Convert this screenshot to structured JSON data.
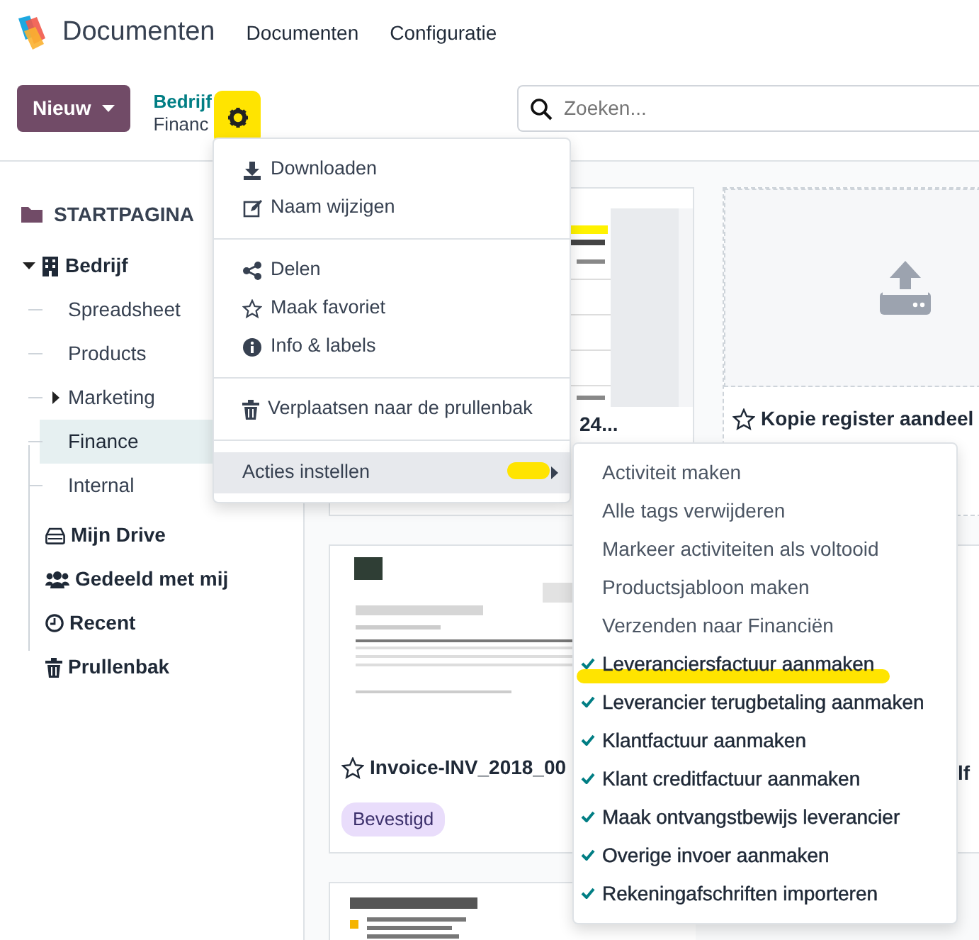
{
  "app": {
    "name": "Documenten"
  },
  "nav": [
    "Documenten",
    "Configuratie"
  ],
  "new_button": {
    "label": "Nieuw"
  },
  "breadcrumb": [
    {
      "label": "Bedrijf",
      "kind": "link"
    },
    {
      "label": "Financ",
      "kind": "current"
    }
  ],
  "search": {
    "placeholder": "Zoeken..."
  },
  "sidebar": {
    "root": "STARTPAGINA",
    "tree": [
      {
        "label": "Bedrijf",
        "expanded": true,
        "selected": false,
        "children": [
          {
            "label": "Spreadsheet",
            "selected": false
          },
          {
            "label": "Products",
            "selected": false
          },
          {
            "label": "Marketing",
            "selected": false,
            "expanded": false
          },
          {
            "label": "Finance",
            "selected": true
          },
          {
            "label": "Internal",
            "selected": false
          }
        ]
      }
    ],
    "items": [
      "Mijn Drive",
      "Gedeeld met mij",
      "Recent",
      "Prullenbak"
    ]
  },
  "cards": [
    {
      "kind": "sheet",
      "title": "24..."
    },
    {
      "kind": "upload",
      "title": "Kopie register aandeel"
    },
    {
      "kind": "invoice",
      "title": "Invoice-INV_2018_00",
      "tag": "Bevestigd"
    },
    {
      "kind": "partial",
      "title": "lf"
    },
    {
      "kind": "letter"
    }
  ],
  "menu": {
    "groups": [
      [
        "Downloaden",
        "Naam wijzigen"
      ],
      [
        "Delen",
        "Maak favoriet",
        "Info & labels"
      ],
      [
        "Verplaatsen naar de prullenbak"
      ]
    ],
    "submenu_item": {
      "label": "Acties instellen",
      "expanded": true
    }
  },
  "submenu": [
    {
      "label": "Activiteit maken",
      "checked": false
    },
    {
      "label": "Alle tags verwijderen",
      "checked": false
    },
    {
      "label": "Markeer activiteiten als voltooid",
      "checked": false
    },
    {
      "label": "Productsjabloon maken",
      "checked": false
    },
    {
      "label": "Verzenden naar Financiën",
      "checked": false
    },
    {
      "label": "Leveranciersfactuur aanmaken",
      "checked": true
    },
    {
      "label": "Leverancier terugbetaling aanmaken",
      "checked": true
    },
    {
      "label": "Klantfactuur aanmaken",
      "checked": true
    },
    {
      "label": "Klant creditfactuur aanmaken",
      "checked": true
    },
    {
      "label": "Maak ontvangstbewijs leverancier",
      "checked": true
    },
    {
      "label": "Overige invoer aanmaken",
      "checked": true
    },
    {
      "label": "Rekeningafschriften importeren",
      "checked": true
    }
  ]
}
